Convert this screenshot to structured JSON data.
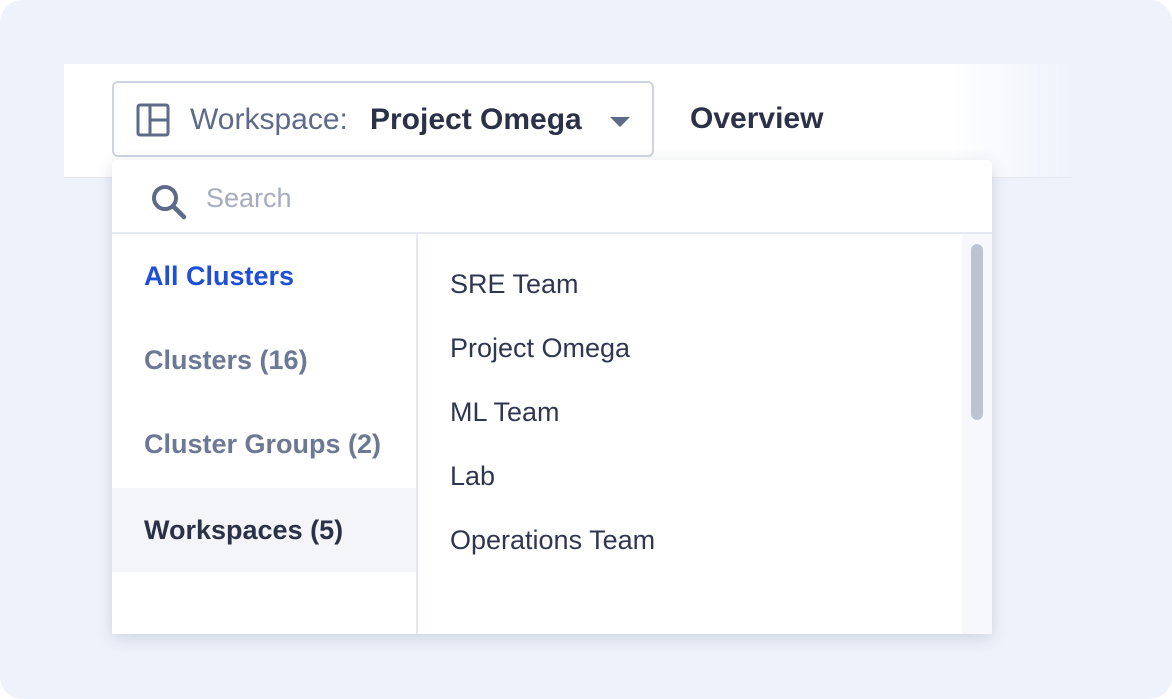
{
  "header": {
    "workspace_prefix": "Workspace:",
    "workspace_value": "Project Omega",
    "overview_label": "Overview"
  },
  "search": {
    "placeholder": "Search",
    "value": ""
  },
  "categories": [
    {
      "label": "All Clusters",
      "state": "active"
    },
    {
      "label": "Clusters (16)",
      "state": "normal"
    },
    {
      "label": "Cluster Groups (2)",
      "state": "normal"
    },
    {
      "label": "Workspaces (5)",
      "state": "selected"
    }
  ],
  "workspaces": [
    {
      "label": "SRE Team"
    },
    {
      "label": "Project Omega"
    },
    {
      "label": "ML Team"
    },
    {
      "label": "Lab"
    },
    {
      "label": "Operations Team"
    }
  ],
  "colors": {
    "accent": "#1f4fd6",
    "background": "#eef2fb",
    "text_primary": "#2b3147",
    "text_muted": "#6d7894"
  },
  "icons": {
    "workspace": "layout-panels-icon",
    "search": "search-icon",
    "caret": "chevron-down-icon"
  }
}
